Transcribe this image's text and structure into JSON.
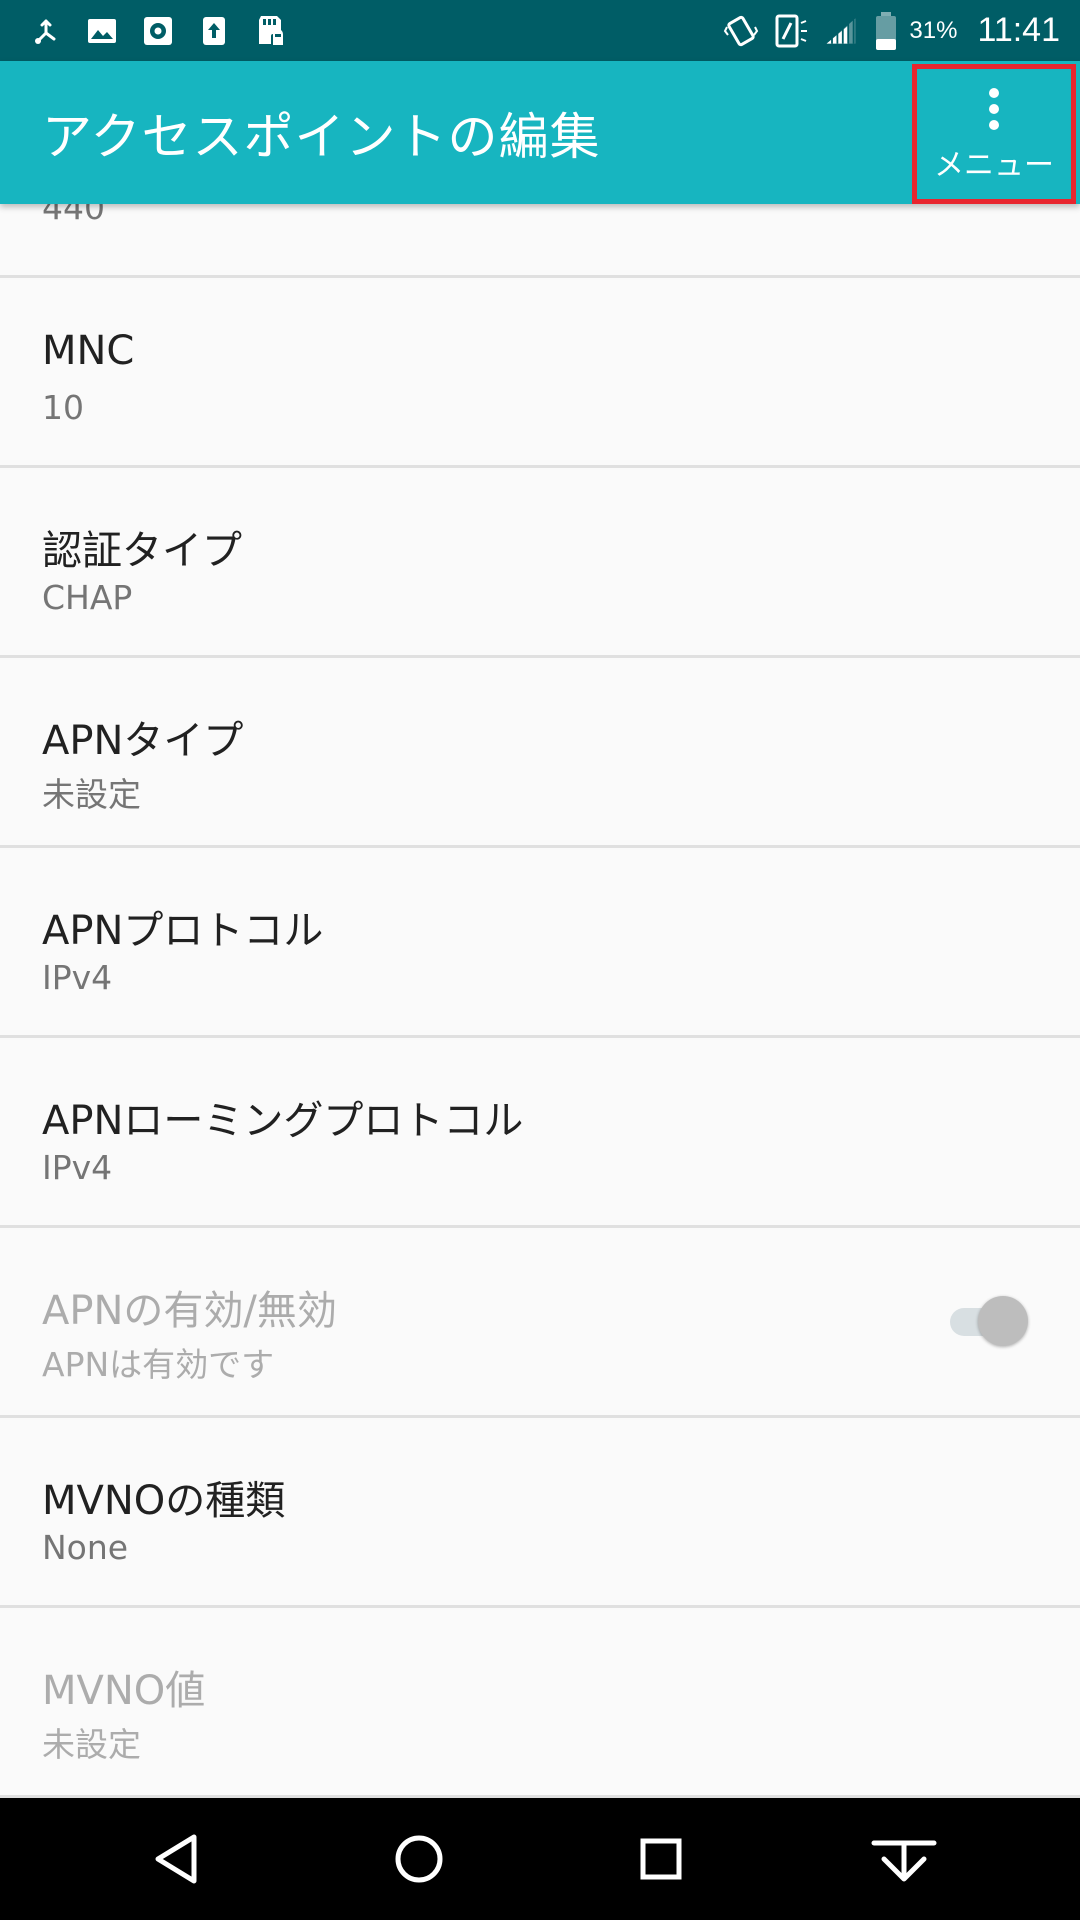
{
  "status_bar": {
    "left_icons": [
      "usb-debug-icon",
      "image-icon",
      "settings-box-icon",
      "upload-icon",
      "sd-card-lock-icon"
    ],
    "right_icons": [
      "vibrate-icon",
      "nfc-icon",
      "signal-icon",
      "battery-icon"
    ],
    "battery_percent": "31%",
    "time": "11:41"
  },
  "app_bar": {
    "title": "アクセスポイントの編集",
    "menu_label": "メニュー",
    "menu_icon": "more-vert-icon",
    "highlight_color": "#e8262f"
  },
  "list": {
    "top_partial_value": "440",
    "items": [
      {
        "title": "MNC",
        "value": "10",
        "enabled": true
      },
      {
        "title": "認証タイプ",
        "value": "CHAP",
        "enabled": true
      },
      {
        "title": "APNタイプ",
        "value": "未設定",
        "enabled": true
      },
      {
        "title": "APNプロトコル",
        "value": "IPv4",
        "enabled": true
      },
      {
        "title": "APNローミングプロトコル",
        "value": "IPv4",
        "enabled": true
      },
      {
        "title": "APNの有効/無効",
        "value": "APNは有効です",
        "enabled": false,
        "toggle": "on"
      },
      {
        "title": "MVNOの種類",
        "value": "None",
        "enabled": true
      },
      {
        "title": "MVNO値",
        "value": "未設定",
        "enabled": false
      }
    ]
  },
  "nav_bar": {
    "buttons": [
      "back-icon",
      "home-icon",
      "recents-icon",
      "hide-nav-icon"
    ]
  },
  "colors": {
    "status_bar": "#005d66",
    "app_bar": "#17b5c0",
    "background": "#fafafa"
  }
}
